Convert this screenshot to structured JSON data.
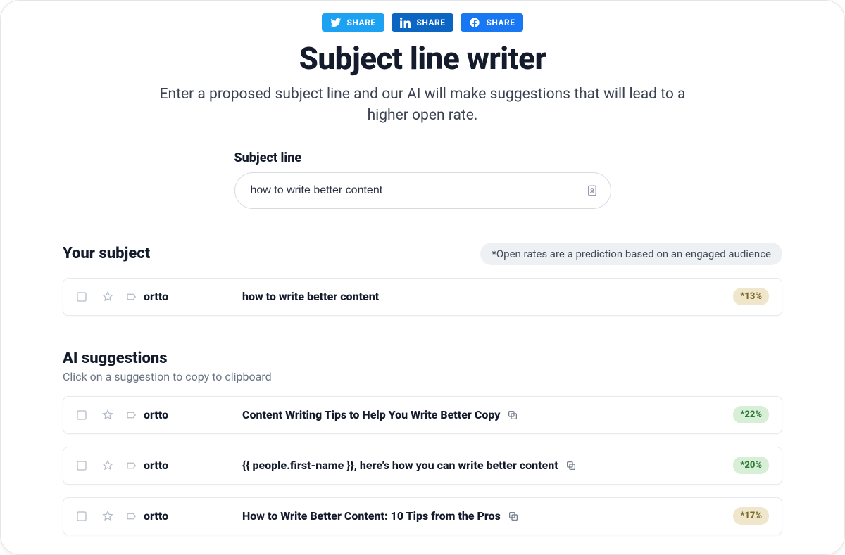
{
  "share": {
    "twitter": "SHARE",
    "linkedin": "SHARE",
    "facebook": "SHARE"
  },
  "page": {
    "title": "Subject line writer",
    "subtitle": "Enter a proposed subject line and our AI will make suggestions that will lead to a higher open rate."
  },
  "input": {
    "label": "Subject line",
    "value": "how to write better content"
  },
  "your_subject": {
    "heading": "Your subject",
    "note": "*Open rates are a prediction based on an engaged audience",
    "row": {
      "sender": "ortto",
      "subject": "how to write better content",
      "rate": "*13%",
      "rate_tone": "yellow"
    }
  },
  "ai": {
    "heading": "AI suggestions",
    "sub": "Click on a suggestion to copy to clipboard",
    "rows": [
      {
        "sender": "ortto",
        "subject": "Content Writing Tips to Help You Write Better Copy",
        "rate": "*22%",
        "rate_tone": "green"
      },
      {
        "sender": "ortto",
        "subject": "{{ people.first-name }}, here's how you can write better content",
        "rate": "*20%",
        "rate_tone": "green"
      },
      {
        "sender": "ortto",
        "subject": "How to Write Better Content: 10 Tips from the Pros",
        "rate": "*17%",
        "rate_tone": "yellow"
      }
    ]
  }
}
